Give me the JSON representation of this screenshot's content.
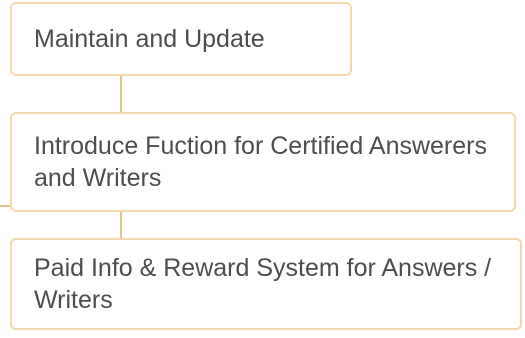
{
  "diagram": {
    "nodes": [
      {
        "label": "Maintain and Update"
      },
      {
        "label": "Introduce Fuction for Certified Answerers and Writers"
      },
      {
        "label": "Paid Info & Reward System for Answers / Writers"
      }
    ],
    "colors": {
      "node_border": "#f1d8ad",
      "connector": "#e7c38a",
      "text": "#4d4d4d",
      "background": "#ffffff"
    }
  }
}
